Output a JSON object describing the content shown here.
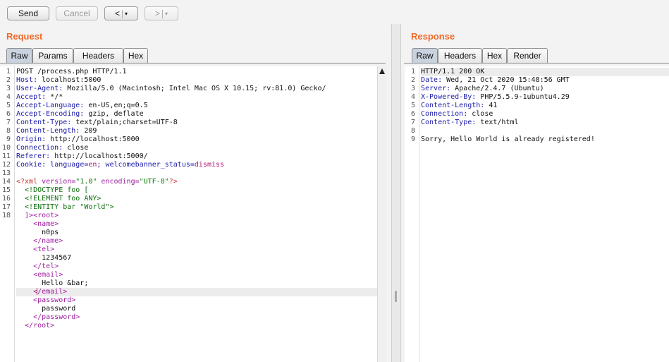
{
  "toolbar": {
    "send_label": "Send",
    "cancel_label": "Cancel",
    "back_glyph": "<",
    "forward_glyph": ">",
    "dropdown_glyph": "▾"
  },
  "request": {
    "title": "Request",
    "tabs": [
      {
        "label": "Raw",
        "active": true
      },
      {
        "label": "Params",
        "active": false
      },
      {
        "label": "Headers",
        "active": false
      },
      {
        "label": "Hex",
        "active": false
      }
    ],
    "line_numbers": [
      "1",
      "2",
      "3",
      "4",
      "5",
      "6",
      "7",
      "8",
      "9",
      "10",
      "11",
      "12",
      "13",
      "14",
      "15",
      "16",
      "17",
      "18"
    ],
    "lines": [
      {
        "text": "POST /process.php HTTP/1.1"
      },
      {
        "key": "Host:",
        "value": " localhost:5000"
      },
      {
        "key": "User-Agent:",
        "value": " Mozilla/5.0 (Macintosh; Intel Mac OS X 10.15; rv:81.0) Gecko/"
      },
      {
        "key": "Accept:",
        "value": " */*"
      },
      {
        "key": "Accept-Language:",
        "value": " en-US,en;q=0.5"
      },
      {
        "key": "Accept-Encoding:",
        "value": " gzip, deflate"
      },
      {
        "key": "Content-Type:",
        "value": " text/plain;charset=UTF-8"
      },
      {
        "key": "Content-Length:",
        "value": " 209"
      },
      {
        "key": "Origin:",
        "value": " http://localhost:5000"
      },
      {
        "key": "Connection:",
        "value": " close"
      },
      {
        "key": "Referer:",
        "value": " http://localhost:5000/"
      },
      {
        "key": "Cookie:",
        "value_parts": [
          " language=",
          "en",
          "; welcomebanner_status=",
          "dismiss"
        ]
      },
      {
        "text": ""
      },
      {
        "xml_decl": [
          "<?xml ",
          "version=",
          "\"1.0\"",
          " encoding=",
          "\"UTF-8\"",
          "?>"
        ]
      },
      {
        "text": "  <!DOCTYPE foo ["
      },
      {
        "text": "  <!ELEMENT foo ANY>"
      },
      {
        "text": "  <!ENTITY bar \"World\">"
      },
      {
        "text": "  ]><root>"
      },
      {
        "text": "    <name>"
      },
      {
        "text": "      n0ps"
      },
      {
        "text": "    </name>"
      },
      {
        "text": "    <tel>"
      },
      {
        "text": "      1234567"
      },
      {
        "text": "    </tel>"
      },
      {
        "text": "    <email>"
      },
      {
        "text": "      Hello &bar;"
      },
      {
        "text": "    </email>"
      },
      {
        "text": "    <password>"
      },
      {
        "text": "      password"
      },
      {
        "text": "    </password>"
      },
      {
        "text": "  </root>"
      }
    ]
  },
  "response": {
    "title": "Response",
    "tabs": [
      {
        "label": "Raw",
        "active": true
      },
      {
        "label": "Headers",
        "active": false
      },
      {
        "label": "Hex",
        "active": false
      },
      {
        "label": "Render",
        "active": false
      }
    ],
    "line_numbers": [
      "1",
      "2",
      "3",
      "4",
      "5",
      "6",
      "7",
      "8",
      "9"
    ],
    "lines": [
      {
        "text": "HTTP/1.1 200 OK"
      },
      {
        "key": "Date:",
        "value": " Wed, 21 Oct 2020 15:48:56 GMT"
      },
      {
        "key": "Server:",
        "value": " Apache/2.4.7 (Ubuntu)"
      },
      {
        "key": "X-Powered-By:",
        "value": " PHP/5.5.9-1ubuntu4.29"
      },
      {
        "key": "Content-Length:",
        "value": " 41"
      },
      {
        "key": "Connection:",
        "value": " close"
      },
      {
        "key": "Content-Type:",
        "value": " text/html"
      },
      {
        "text": ""
      },
      {
        "text": "Sorry, Hello World is already registered!"
      }
    ]
  },
  "colors": {
    "title_accent": "#f06a28",
    "header_key": "#1a1aa8",
    "xml_tag": "#a020a0",
    "xml_string": "#0b7a0b",
    "active_tab": "#c9d3df"
  }
}
